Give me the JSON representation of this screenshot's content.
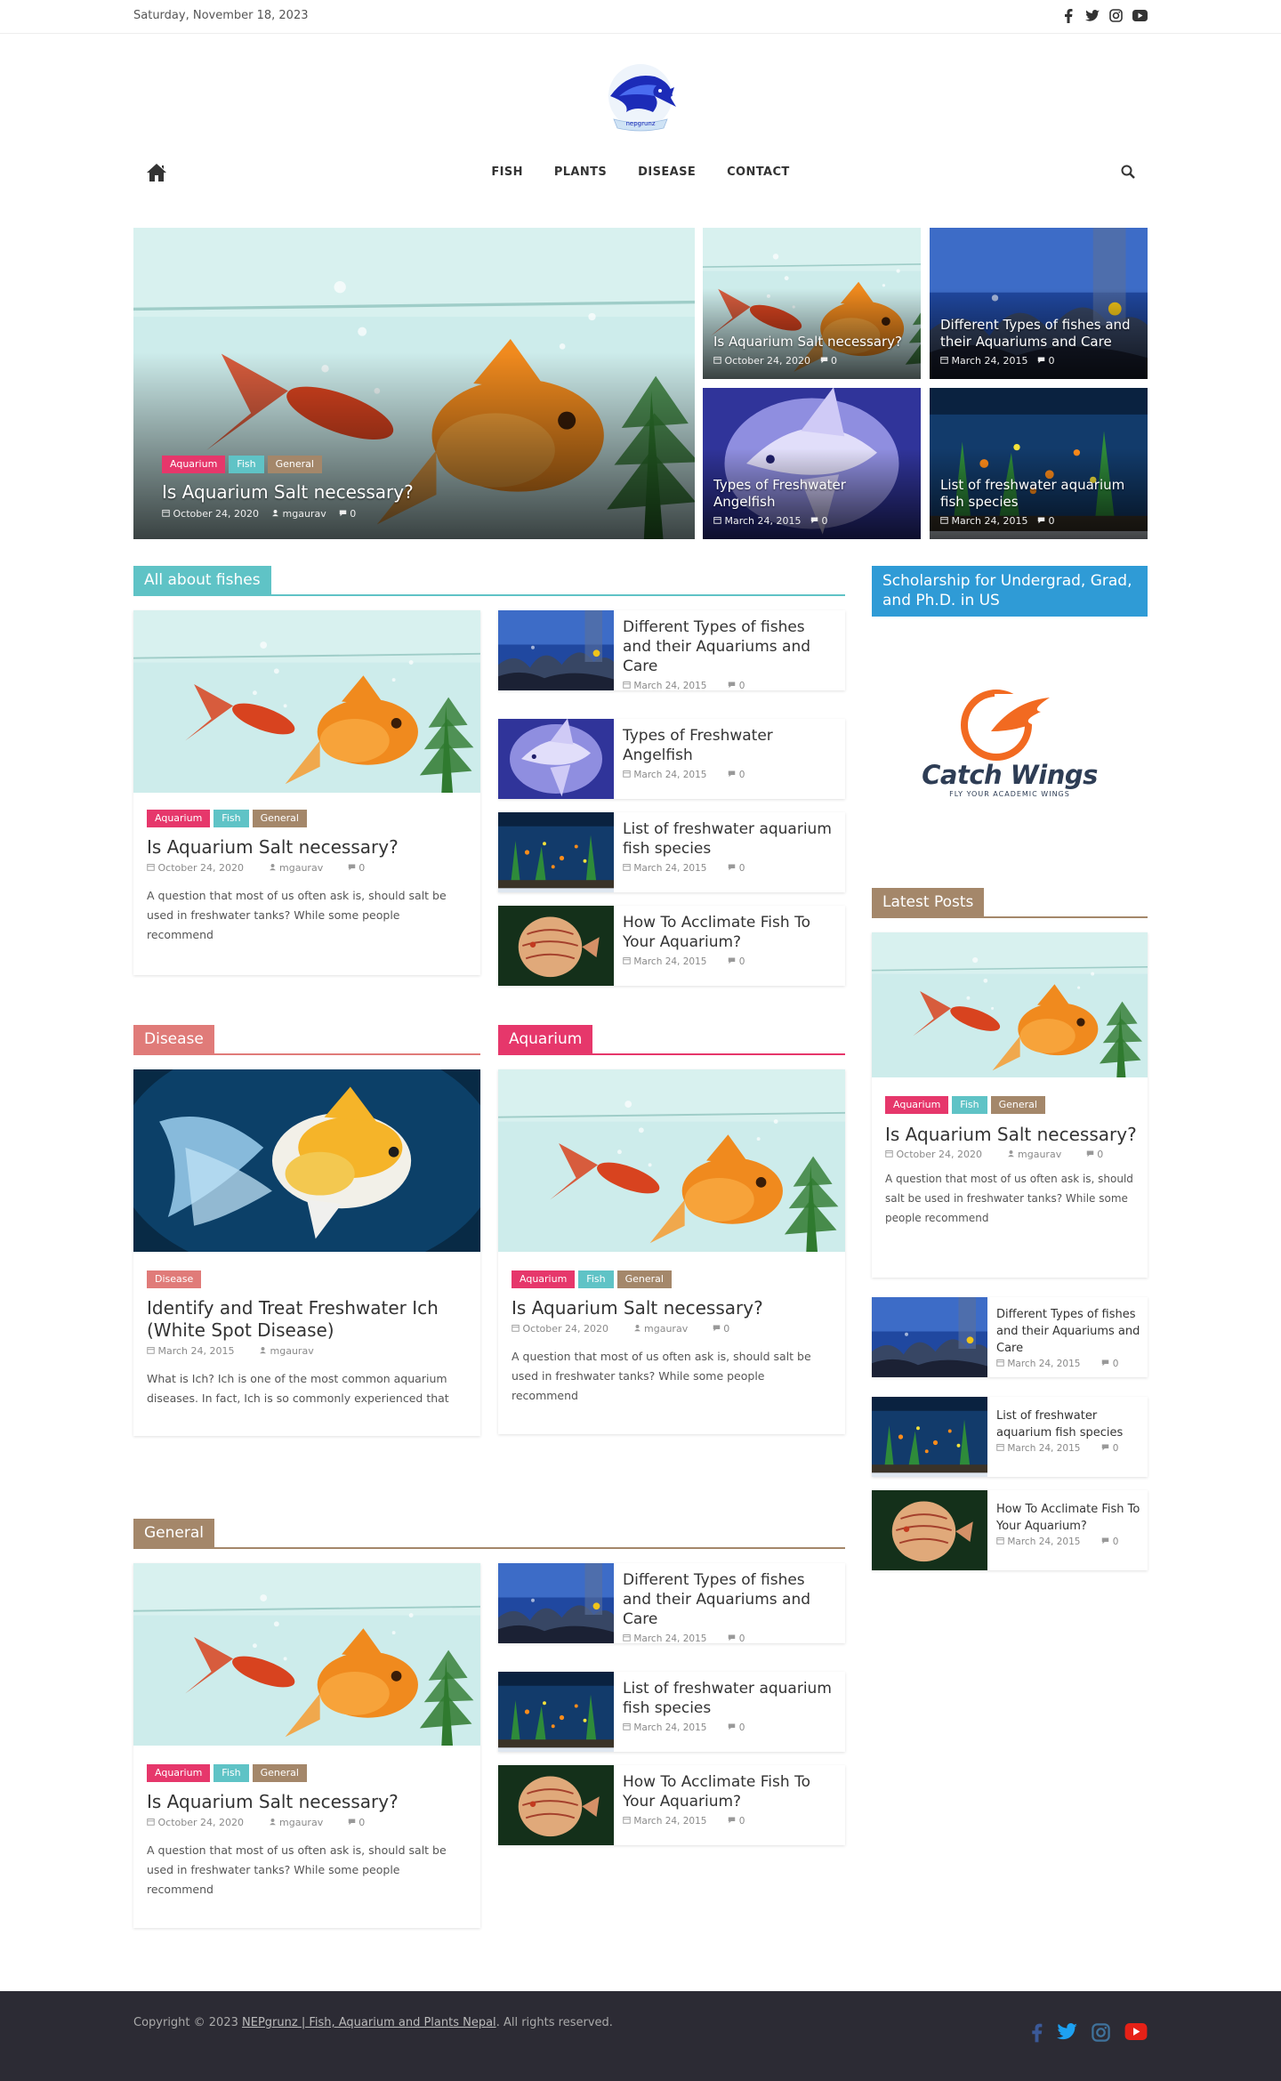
{
  "topbar": {
    "date": "Saturday, November 18, 2023"
  },
  "brand": {
    "logo_text": "nepgrunz"
  },
  "nav": {
    "items": [
      "FISH",
      "PLANTS",
      "DISEASE",
      "CONTACT"
    ]
  },
  "hero": {
    "main": {
      "tags": [
        "Aquarium",
        "Fish",
        "General"
      ],
      "title": "Is Aquarium Salt necessary?",
      "date": "October 24, 2020",
      "author": "mgaurav",
      "comments": "0"
    },
    "tiles": [
      {
        "title": "Is Aquarium Salt necessary?",
        "date": "October 24, 2020",
        "comments": "0"
      },
      {
        "title": "Different Types of fishes and their Aquariums and Care",
        "date": "March 24, 2015",
        "comments": "0"
      },
      {
        "title": "Types of Freshwater Angelfish",
        "date": "March 24, 2015",
        "comments": "0"
      },
      {
        "title": "List of freshwater aquarium fish species",
        "date": "March 24, 2015",
        "comments": "0"
      }
    ]
  },
  "fishes": {
    "heading": "All about fishes",
    "main": {
      "tags": [
        "Aquarium",
        "Fish",
        "General"
      ],
      "title": "Is Aquarium Salt necessary?",
      "date": "October 24, 2020",
      "author": "mgaurav",
      "comments": "0",
      "excerpt": "A question that most of us often ask is, should salt be used in freshwater tanks? While some people recommend"
    },
    "list": [
      {
        "title": "Different Types of fishes and their Aquariums and Care",
        "date": "March 24, 2015",
        "comments": "0"
      },
      {
        "title": "Types of Freshwater Angelfish",
        "date": "March 24, 2015",
        "comments": "0"
      },
      {
        "title": "List of freshwater aquarium fish species",
        "date": "March 24, 2015",
        "comments": "0"
      },
      {
        "title": "How To Acclimate Fish To Your Aquarium?",
        "date": "March 24, 2015",
        "comments": "0"
      }
    ]
  },
  "disease": {
    "heading": "Disease",
    "main": {
      "tags": [
        "Disease"
      ],
      "title": "Identify and Treat Freshwater Ich (White Spot Disease)",
      "date": "March 24, 2015",
      "author": "mgaurav",
      "excerpt": "What is Ich? Ich is one of the most common aquarium diseases. In fact, Ich is so commonly experienced that"
    }
  },
  "aquarium": {
    "heading": "Aquarium",
    "main": {
      "tags": [
        "Aquarium",
        "Fish",
        "General"
      ],
      "title": "Is Aquarium Salt necessary?",
      "date": "October 24, 2020",
      "author": "mgaurav",
      "comments": "0",
      "excerpt": "A question that most of us often ask is, should salt be used in freshwater tanks? While some people recommend"
    }
  },
  "general": {
    "heading": "General",
    "main": {
      "tags": [
        "Aquarium",
        "Fish",
        "General"
      ],
      "title": "Is Aquarium Salt necessary?",
      "date": "October 24, 2020",
      "author": "mgaurav",
      "comments": "0",
      "excerpt": "A question that most of us often ask is, should salt be used in freshwater tanks? While some people recommend"
    },
    "list": [
      {
        "title": "Different Types of fishes and their Aquariums and Care",
        "date": "March 24, 2015",
        "comments": "0"
      },
      {
        "title": "List of freshwater aquarium fish species",
        "date": "March 24, 2015",
        "comments": "0"
      },
      {
        "title": "How To Acclimate Fish To Your Aquarium?",
        "date": "March 24, 2015",
        "comments": "0"
      }
    ]
  },
  "sidebar": {
    "ad_heading": "Scholarship for Undergrad, Grad, and Ph.D. in US",
    "ad_brand": "Catch Wings",
    "ad_tagline": "FLY YOUR ACADEMIC WINGS",
    "latest_heading": "Latest Posts",
    "latest_main": {
      "tags": [
        "Aquarium",
        "Fish",
        "General"
      ],
      "title": "Is Aquarium Salt necessary?",
      "date": "October 24, 2020",
      "author": "mgaurav",
      "comments": "0",
      "excerpt": "A question that most of us often ask is, should salt be used in freshwater tanks? While some people recommend"
    },
    "latest_list": [
      {
        "title": "Different Types of fishes and their Aquariums and Care",
        "date": "March 24, 2015",
        "comments": "0"
      },
      {
        "title": "List of freshwater aquarium fish species",
        "date": "March 24, 2015",
        "comments": "0"
      },
      {
        "title": "How To Acclimate Fish To Your Aquarium?",
        "date": "March 24, 2015",
        "comments": "0"
      }
    ]
  },
  "footer": {
    "copy_prefix": "Copyright © 2023",
    "site_link": "NEPgrunz | Fish, Aquarium and Plants Nepal",
    "copy_suffix": ". All rights reserved."
  },
  "colors": {
    "fishes": "#5fc3c6",
    "disease": "#e07b79",
    "aquarium": "#e6376b",
    "general": "#a4876a",
    "sidebar_ad": "#2f9bd6",
    "footer": "#2c2b34"
  },
  "icons": [
    "facebook-icon",
    "twitter-icon",
    "instagram-icon",
    "youtube-icon",
    "home-icon",
    "search-icon",
    "calendar-icon",
    "user-icon",
    "comment-icon"
  ]
}
